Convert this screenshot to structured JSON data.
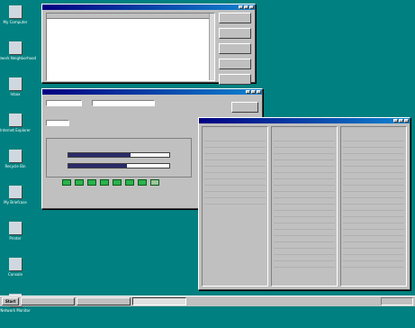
{
  "desktop": {
    "icons": [
      {
        "label": "My Computer",
        "icon": "computer-icon"
      },
      {
        "label": "Network Neighborhood",
        "icon": "network-icon"
      },
      {
        "label": "Inbox",
        "icon": "inbox-icon"
      },
      {
        "label": "Internet Explorer",
        "icon": "browser-icon"
      },
      {
        "label": "Recycle Bin",
        "icon": "recycle-bin-icon"
      },
      {
        "label": "My Briefcase",
        "icon": "briefcase-icon"
      },
      {
        "label": "Printer",
        "icon": "printer-icon"
      },
      {
        "label": "Console",
        "icon": "console-icon"
      },
      {
        "label": "Network Monitor",
        "icon": "monitor-icon"
      }
    ]
  },
  "window_list": {
    "title": "",
    "columns": [
      "",
      "",
      "",
      "",
      "",
      "",
      ""
    ],
    "rows": [
      [
        "",
        "",
        "",
        "",
        "",
        "",
        ""
      ],
      [
        "",
        "",
        "",
        "",
        "",
        "",
        ""
      ],
      [
        "",
        "",
        "",
        "",
        "",
        "",
        ""
      ],
      [
        "",
        "",
        "",
        "",
        "",
        "",
        ""
      ],
      [
        "",
        "",
        "",
        "",
        "",
        "",
        ""
      ],
      [
        "",
        "",
        "",
        "",
        "",
        "",
        ""
      ],
      [
        "",
        "",
        "",
        "",
        "",
        "",
        ""
      ],
      [
        "",
        "",
        "",
        "",
        "",
        "",
        ""
      ]
    ],
    "buttons": [
      "",
      "",
      "",
      "",
      ""
    ]
  },
  "window_status": {
    "title": "",
    "field1_label": "",
    "field1_value": "",
    "field2_label": "",
    "field2_value": "",
    "line2": "",
    "line3_label": "",
    "line3_value": "",
    "group_title": "",
    "gauge1_label": "",
    "gauge1_fraction": 0.62,
    "gauge2_label": "",
    "gauge2_fraction": 0.58,
    "side_button": "",
    "leds_label": "",
    "led_count": 8
  },
  "window_info": {
    "title": "",
    "col1": {
      "title": "",
      "rows": [
        [
          "",
          ""
        ],
        [
          "",
          ""
        ],
        [
          "",
          ""
        ],
        [
          "",
          ""
        ],
        [
          "",
          ""
        ],
        [
          "",
          ""
        ],
        [
          "",
          ""
        ],
        [
          "",
          ""
        ],
        [
          "",
          ""
        ],
        [
          "",
          ""
        ],
        [
          "",
          ""
        ]
      ]
    },
    "col2": {
      "title": "",
      "rows": [
        [
          "",
          ""
        ],
        [
          "",
          ""
        ],
        [
          "",
          ""
        ],
        [
          "",
          ""
        ],
        [
          "",
          ""
        ],
        [
          "",
          ""
        ],
        [
          "",
          ""
        ],
        [
          "",
          ""
        ],
        [
          "",
          ""
        ],
        [
          "",
          ""
        ],
        [
          "",
          ""
        ],
        [
          "",
          ""
        ],
        [
          "",
          ""
        ],
        [
          "",
          ""
        ],
        [
          "",
          ""
        ],
        [
          "",
          ""
        ],
        [
          "",
          ""
        ],
        [
          "",
          ""
        ],
        [
          "",
          ""
        ],
        [
          "",
          ""
        ],
        [
          "",
          ""
        ]
      ]
    },
    "col3": {
      "title": "",
      "rows": [
        [
          "",
          ""
        ],
        [
          "",
          ""
        ],
        [
          "",
          ""
        ],
        [
          "",
          ""
        ],
        [
          "",
          ""
        ],
        [
          "",
          ""
        ],
        [
          "",
          ""
        ],
        [
          "",
          ""
        ],
        [
          "",
          ""
        ],
        [
          "",
          ""
        ],
        [
          "",
          ""
        ],
        [
          "",
          ""
        ],
        [
          "",
          ""
        ],
        [
          "",
          ""
        ],
        [
          "",
          ""
        ],
        [
          "",
          ""
        ],
        [
          "",
          ""
        ],
        [
          "",
          ""
        ],
        [
          "",
          ""
        ],
        [
          "",
          ""
        ],
        [
          "",
          ""
        ]
      ]
    }
  },
  "taskbar": {
    "start_label": "Start",
    "tasks": [
      "",
      "",
      ""
    ],
    "clock": ""
  },
  "colors": {
    "desktop": "#008080",
    "titlebar": "#000080"
  }
}
